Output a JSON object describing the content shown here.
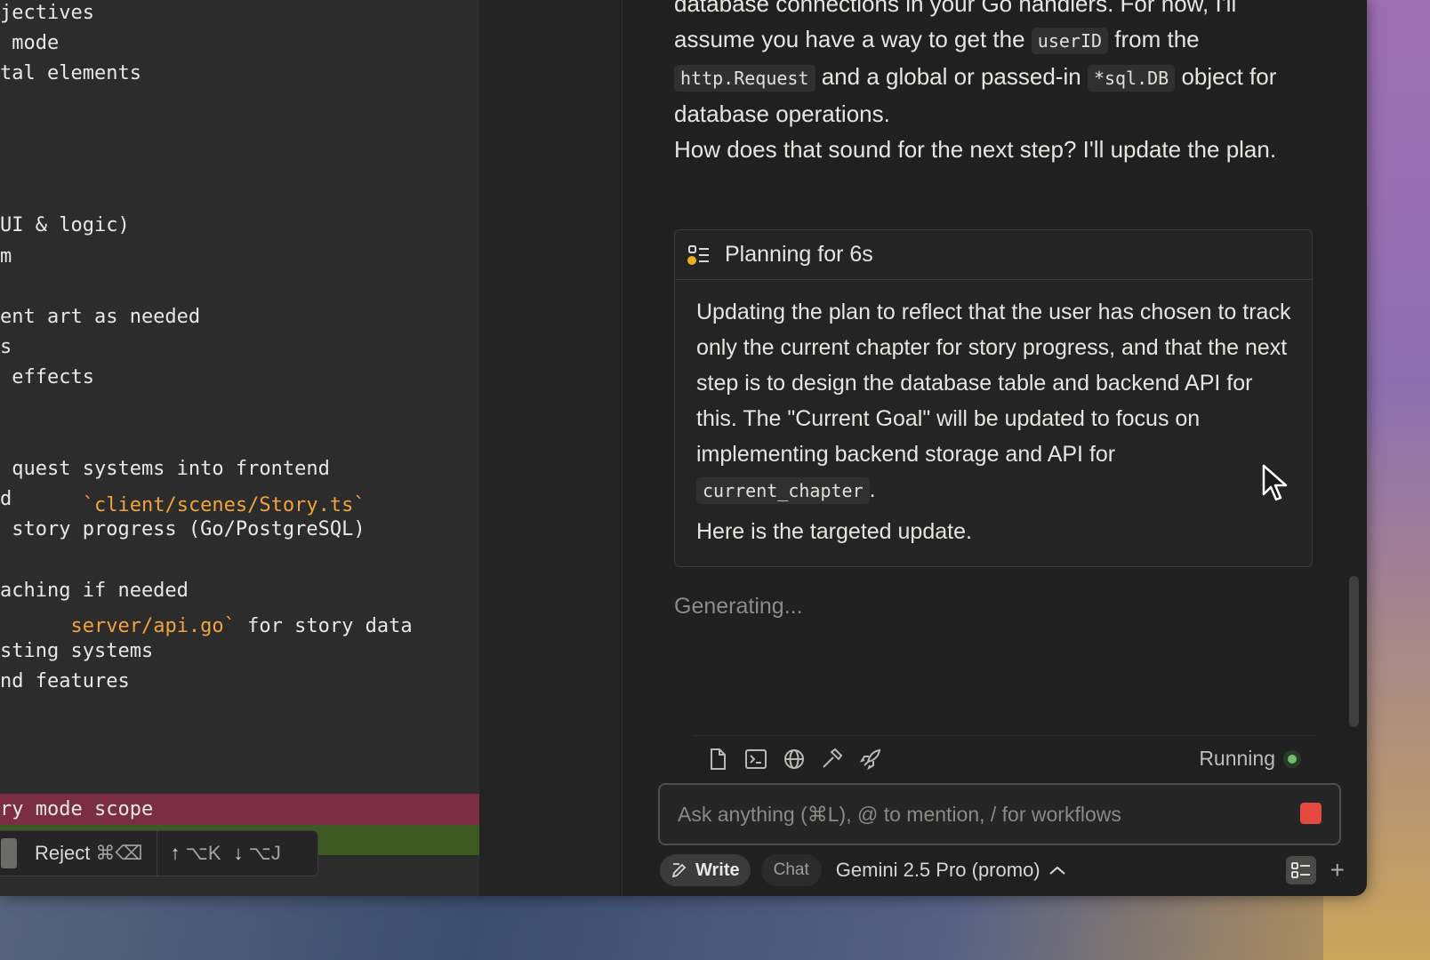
{
  "editor": {
    "lines": [
      {
        "text": "jectives",
        "y": 0
      },
      {
        "text": " mode",
        "y": 1
      },
      {
        "text": "tal elements",
        "y": 2
      },
      {
        "text": "UI & logic)",
        "y": 7
      },
      {
        "text": "m",
        "y": 8
      },
      {
        "text": "ent art as needed",
        "y": 10
      },
      {
        "text": "s",
        "y": 11
      },
      {
        "text": " effects",
        "y": 12
      },
      {
        "text": " quest systems into frontend",
        "y": 15
      },
      {
        "text": "d",
        "y": 16
      },
      {
        "text": " story progress (Go/PostgreSQL)",
        "y": 17
      },
      {
        "text": "aching if needed",
        "y": 19
      },
      {
        "text": "sting systems",
        "y": 21
      },
      {
        "text": "nd features",
        "y": 22
      }
    ],
    "story_ts_line": "`client/scenes/Story.ts`",
    "api_go_path": "server/api.go`",
    "api_go_rest": " for story data",
    "removed_line": "ry mode scope",
    "reject_label": "Reject",
    "reject_shortcut": "⌘⌫",
    "prev_shortcut": "⌥K",
    "next_shortcut": "⌥J"
  },
  "chat": {
    "para1_a": "database connections in your Go handlers. For now, I'll assume you have a way to get the ",
    "para1_code1": "userID",
    "para1_b": " from the ",
    "para1_code2": "http.Request",
    "para1_c": " and a global or passed-in ",
    "para1_code3": "*sql.DB",
    "para1_d": " object for database operations.",
    "para2": "How does that sound for the next step? I'll update the plan.",
    "plan_title": "Planning for 6s",
    "plan_body_a": "Updating the plan to reflect that the user has chosen to track only the current chapter for story progress, and that the next step is to design the database table and backend API for this. The \"Current Goal\" will be updated to focus on implementing backend storage and API for ",
    "plan_body_code": "current_chapter",
    "plan_body_b": ".",
    "plan_body_2": "Here is the targeted update.",
    "generating": "Generating...",
    "status": "Running",
    "input_placeholder": "Ask anything (⌘L), @ to mention, / for workflows",
    "mode_write": "Write",
    "mode_chat": "Chat",
    "model": "Gemini 2.5 Pro (promo)"
  },
  "colors": {
    "accent_orange": "#f1a33c",
    "stop_red": "#e5483f",
    "running_green": "#6ebc6e",
    "diff_removed": "#7b2e43",
    "diff_added": "#3c5a22"
  },
  "icons": [
    "file-icon",
    "terminal-icon",
    "globe-icon",
    "hammer-icon",
    "rocket-icon"
  ]
}
